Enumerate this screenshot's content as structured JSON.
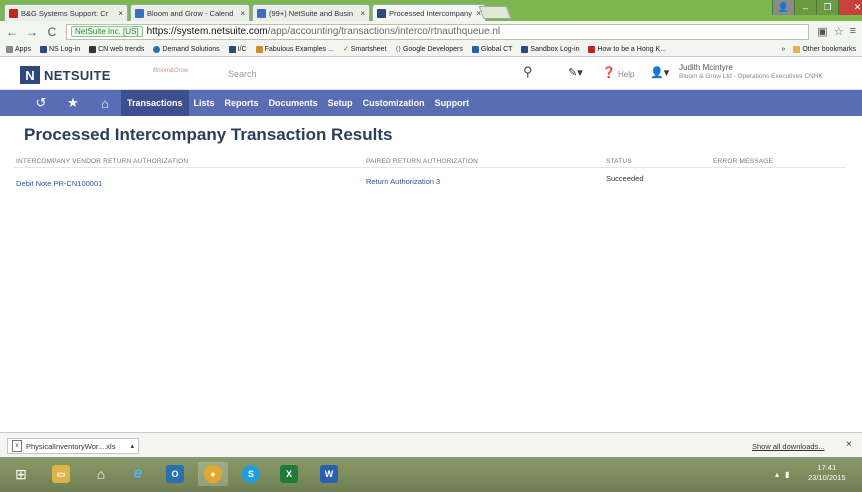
{
  "browser": {
    "tabs": [
      {
        "title": "B&G Systems Support: Cr",
        "favicon_color": "#c5221f"
      },
      {
        "title": "Bloom and Grow - Calend",
        "favicon_color": "#3a6fc4"
      },
      {
        "title": "(99+) NetSuite and Busin",
        "favicon_color": "#3a6fc4"
      },
      {
        "title": "Processed Intercompany",
        "favicon_color": "#2c4b7a"
      }
    ],
    "active_tab": 3,
    "url_security_label": "NetSuite Inc. [US]",
    "url_host": "https://system.netsuite.com",
    "url_path": "/app/accounting/transactions/interco/rtnauthqueue.nl",
    "bookmarks": [
      {
        "label": "Apps",
        "color": "#666"
      },
      {
        "label": "NS Log-in",
        "color": "#2c4b7a"
      },
      {
        "label": "CN web trends",
        "color": "#333"
      },
      {
        "label": "Demand Solutions",
        "color": "#2a6fb0"
      },
      {
        "label": "I/C",
        "color": "#2c4b7a"
      },
      {
        "label": "Fabulous Examples ...",
        "color": "#d28a2a"
      },
      {
        "label": "Smartsheet",
        "color": "#2a8a2a"
      },
      {
        "label": "Google Developers",
        "color": "#555"
      },
      {
        "label": "Global CT",
        "color": "#2a5fb0"
      },
      {
        "label": "Sandbox Log-in",
        "color": "#2c4b7a"
      },
      {
        "label": "How to be a Hong K...",
        "color": "#c5221f"
      }
    ],
    "other_bookmarks": "Other bookmarks"
  },
  "netsuite": {
    "logo_text": "NETSUITE",
    "logo_mark": "N",
    "brand_text": "Bloom&Grow",
    "search_placeholder": "Search",
    "help_label": "Help",
    "user_name": "Judith Mcintyre",
    "user_role": "Bloom & Grow Ltd - Operations Executives CNHK",
    "menu": [
      {
        "label": "Transactions",
        "active": true
      },
      {
        "label": "Lists"
      },
      {
        "label": "Reports"
      },
      {
        "label": "Documents"
      },
      {
        "label": "Setup"
      },
      {
        "label": "Customization"
      },
      {
        "label": "Support"
      }
    ]
  },
  "page": {
    "title": "Processed Intercompany Transaction Results",
    "columns": [
      "Intercompany Vendor Return Authorization",
      "Paired Return Authorization",
      "Status",
      "Error Message"
    ],
    "rows": [
      {
        "vendor_return": "Debit Note PR-CN100001",
        "paired_return": "Return Authorization 3",
        "status": "Succeeded",
        "error": ""
      }
    ]
  },
  "downloads": {
    "file_name": "PhysicalInventoryWor....xls",
    "show_all": "Show all downloads...",
    "close": "×"
  },
  "taskbar": {
    "time": "17:41",
    "date": "23/10/2015"
  }
}
